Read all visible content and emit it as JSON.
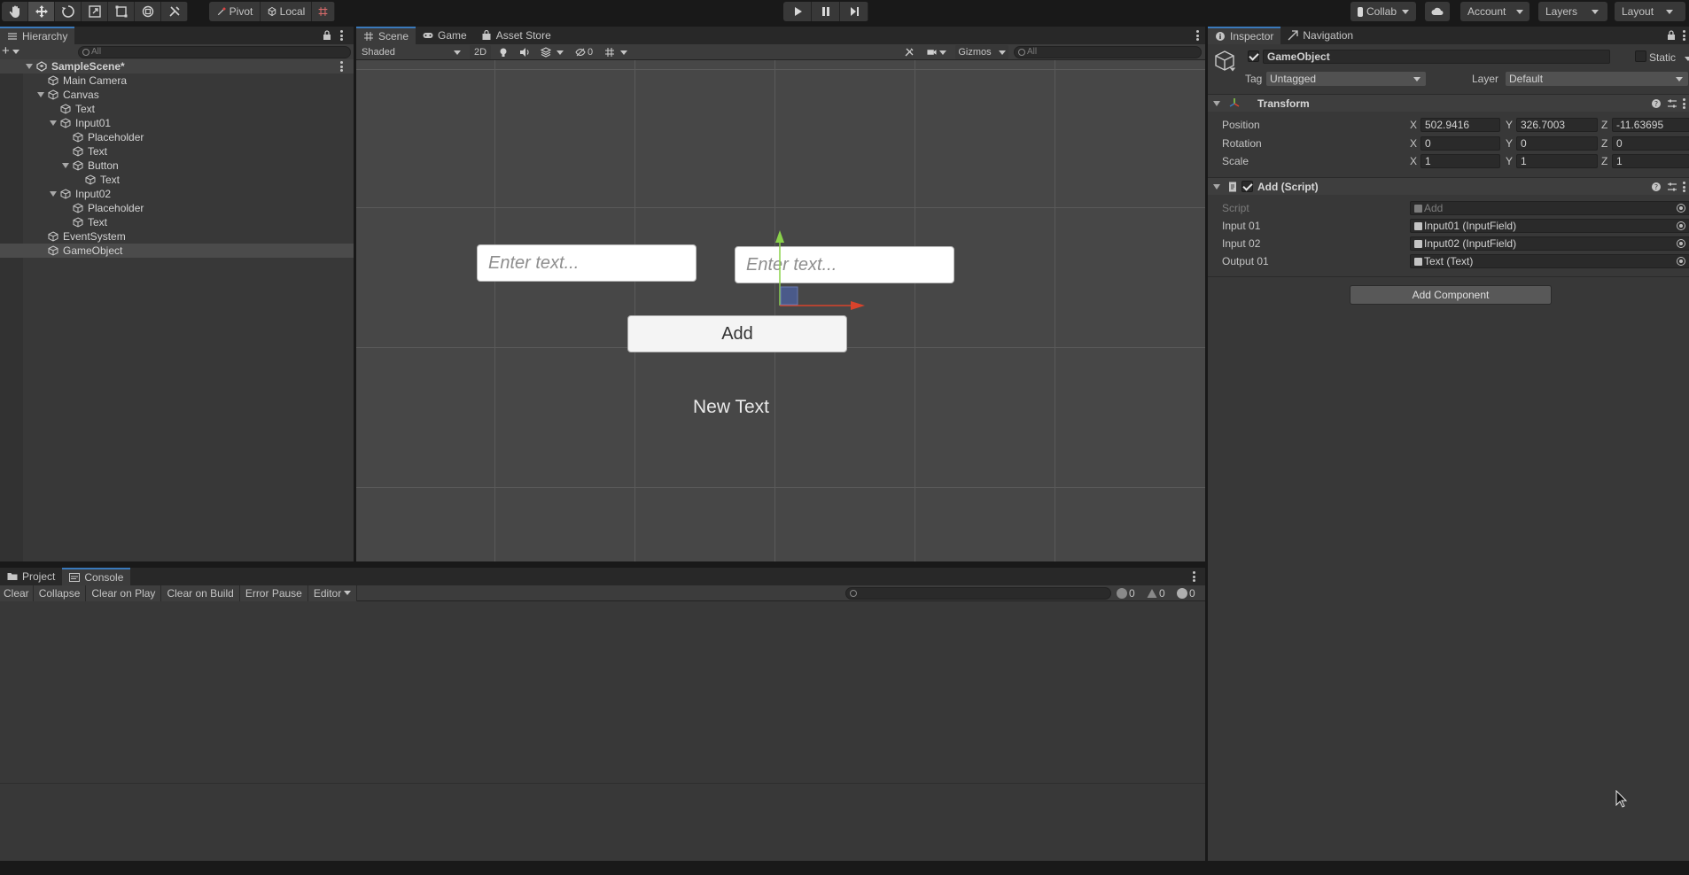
{
  "toolbar": {
    "pivot_label": "Pivot",
    "local_label": "Local",
    "collab_label": "Collab",
    "account_label": "Account",
    "layers_label": "Layers",
    "layout_label": "Layout"
  },
  "hierarchy": {
    "tab_label": "Hierarchy",
    "search_placeholder": "All",
    "items": [
      {
        "label": "SampleScene*"
      },
      {
        "label": "Main Camera"
      },
      {
        "label": "Canvas"
      },
      {
        "label": "Text"
      },
      {
        "label": "Input01"
      },
      {
        "label": "Placeholder"
      },
      {
        "label": "Text"
      },
      {
        "label": "Button"
      },
      {
        "label": "Text"
      },
      {
        "label": "Input02"
      },
      {
        "label": "Placeholder"
      },
      {
        "label": "Text"
      },
      {
        "label": "EventSystem"
      },
      {
        "label": "GameObject"
      }
    ]
  },
  "scene": {
    "tabs": [
      {
        "label": "Scene"
      },
      {
        "label": "Game"
      },
      {
        "label": "Asset Store"
      }
    ],
    "shading_mode": "Shaded",
    "mode_2d": "2D",
    "hidden_count": "0",
    "gizmos_label": "Gizmos",
    "search_placeholder": "All",
    "input01_placeholder": "Enter text...",
    "input02_placeholder": "Enter text...",
    "button_label": "Add",
    "output_text": "New Text"
  },
  "console": {
    "tabs": [
      {
        "label": "Project"
      },
      {
        "label": "Console"
      }
    ],
    "buttons": {
      "clear": "Clear",
      "collapse": "Collapse",
      "clear_on_play": "Clear on Play",
      "clear_on_build": "Clear on Build",
      "error_pause": "Error Pause",
      "editor": "Editor"
    },
    "log_count": "0",
    "warning_count": "0",
    "error_count": "0"
  },
  "inspector": {
    "tabs": [
      {
        "label": "Inspector"
      },
      {
        "label": "Navigation"
      }
    ],
    "object_name": "GameObject",
    "static_label": "Static",
    "tag_label": "Tag",
    "tag_value": "Untagged",
    "layer_label": "Layer",
    "layer_value": "Default",
    "transform": {
      "title": "Transform",
      "position_label": "Position",
      "rotation_label": "Rotation",
      "scale_label": "Scale",
      "x_label": "X",
      "y_label": "Y",
      "z_label": "Z",
      "position": {
        "x": "502.9416",
        "y": "326.7003",
        "z": "-11.63695"
      },
      "rotation": {
        "x": "0",
        "y": "0",
        "z": "0"
      },
      "scale": {
        "x": "1",
        "y": "1",
        "z": "1"
      }
    },
    "script_component": {
      "title": "Add (Script)",
      "script_label": "Script",
      "script_value": "Add",
      "input01_label": "Input 01",
      "input01_value": "Input01 (InputField)",
      "input02_label": "Input 02",
      "input02_value": "Input02 (InputField)",
      "output01_label": "Output 01",
      "output01_value": "Text (Text)"
    },
    "add_component_label": "Add Component"
  },
  "colors": {
    "accent_tab": "#3a79bb",
    "gizmo_x": "#d8432c",
    "gizmo_y": "#8ad24a"
  }
}
